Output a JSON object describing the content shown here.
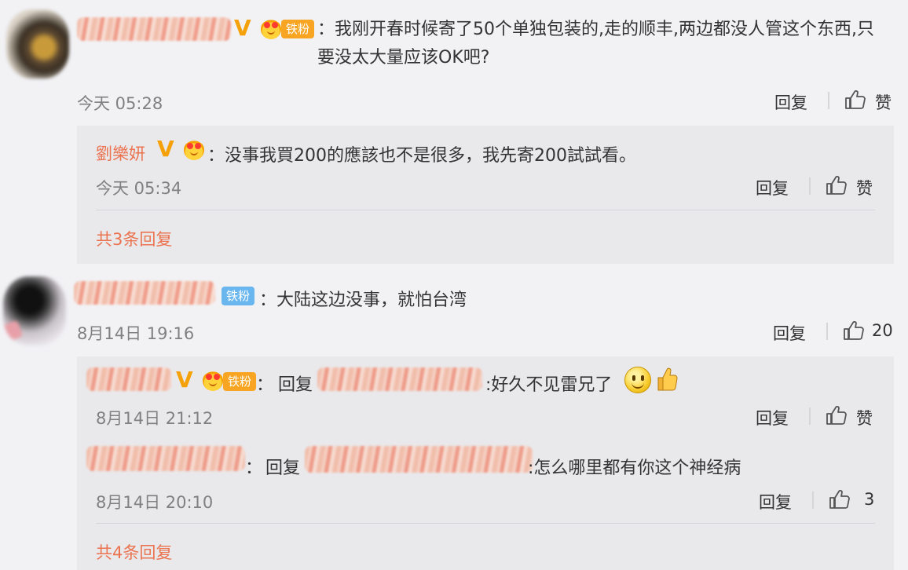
{
  "comments": [
    {
      "tag": "铁粉",
      "text": "：我刚开春时候寄了50个单独包装的,走的顺丰,两边都没人管这个东西,只要没太大量应该OK吧?",
      "time": "今天 05:28",
      "reply_label": "回复",
      "like_label": "赞",
      "replies": [
        {
          "name": "劉樂妍",
          "text": "：没事我買200的應該也不是很多，我先寄200試試看。",
          "time": "今天 05:34",
          "reply_label": "回复",
          "like_label": "赞"
        }
      ],
      "more_replies": "共3条回复"
    },
    {
      "tag": "铁粉",
      "text": "：大陆这边没事，就怕台湾",
      "time": "8月14日 19:16",
      "reply_label": "回复",
      "like_count": "20",
      "replies": [
        {
          "tag": "铁粉",
          "prefix": "：",
          "reply_word": "回复",
          "text": ":好久不见雷兄了",
          "time": "8月14日 21:12",
          "reply_label": "回复",
          "like_label": "赞"
        },
        {
          "prefix": "：",
          "reply_word": "回复",
          "text": ":怎么哪里都有你这个神经病",
          "time": "8月14日 20:10",
          "reply_label": "回复",
          "like_count": "3"
        }
      ],
      "more_replies": "共4条回复"
    }
  ],
  "colors": {
    "name": "#eb7350",
    "vip_v": "#f5a10a",
    "tag_orange": "#f7a523",
    "tag_blue": "#6ab7ef",
    "time": "#808080"
  },
  "icons": [
    "verified-v-icon",
    "crown-medal-icon",
    "thumbs-up-icon",
    "smile-emoji-icon",
    "thumbs-up-emoji-icon"
  ]
}
